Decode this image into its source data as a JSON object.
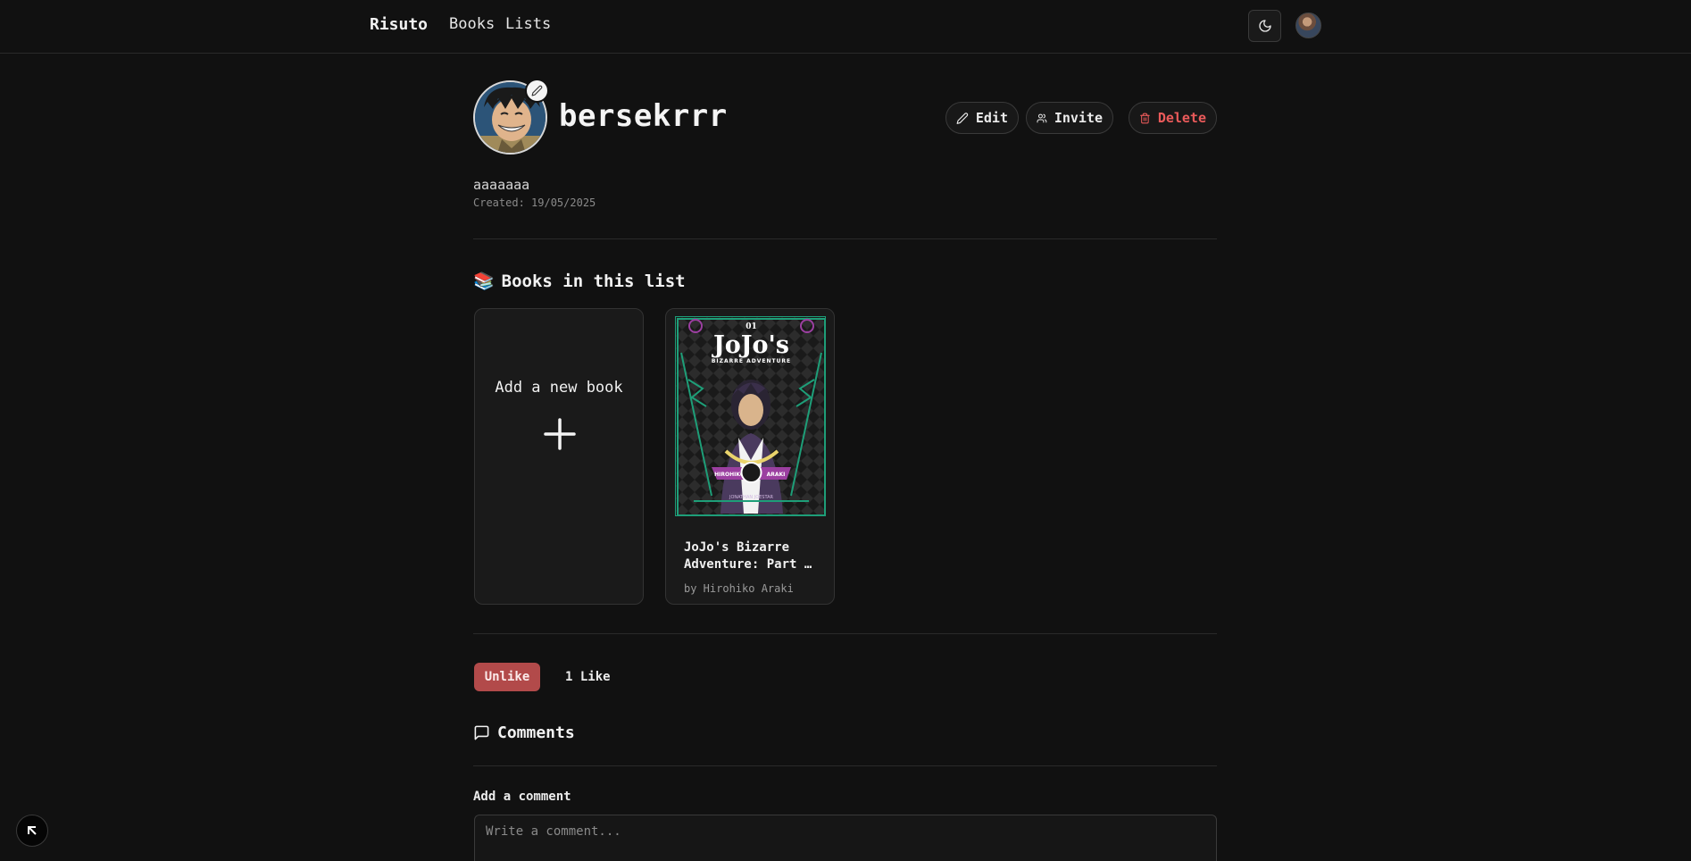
{
  "nav": {
    "brand": "Risuto",
    "links": [
      {
        "label": "Books"
      },
      {
        "label": "Lists"
      }
    ]
  },
  "list": {
    "title": "bersekrrr",
    "description": "aaaaaaa",
    "created": "Created: 19/05/2025",
    "actions": {
      "edit": "Edit",
      "invite": "Invite",
      "delete": "Delete"
    }
  },
  "books_section": {
    "emoji": "📚",
    "title": "Books in this list",
    "add_label": "Add a new book",
    "books": [
      {
        "title": "JoJo's Bizarre Adventure: Part …",
        "author": "by Hirohiko Araki",
        "cover": {
          "volume": "01",
          "title": "JoJo's",
          "subtitle": "BIZARRE ADVENTURE",
          "ribbon_left": "HIROHIKO",
          "ribbon_right": "ARAKI",
          "bottom_text": "JONATHAN JOESTAR"
        }
      }
    ]
  },
  "likes": {
    "unlike_label": "Unlike",
    "count_text": "1 Like"
  },
  "comments": {
    "title": "Comments",
    "add_label": "Add a comment",
    "placeholder": "Write a comment..."
  },
  "colors": {
    "background": "#111111",
    "danger": "#ea5a5a",
    "unlike_bg": "#b24a4a",
    "cover_accent": "#1e9e78",
    "cover_purple": "#9b3fa0"
  },
  "icons": {
    "theme": "moon-icon",
    "edit": "pencil-icon",
    "invite": "users-icon",
    "delete": "trash-icon",
    "comments": "message-square-icon",
    "add": "plus-icon"
  }
}
